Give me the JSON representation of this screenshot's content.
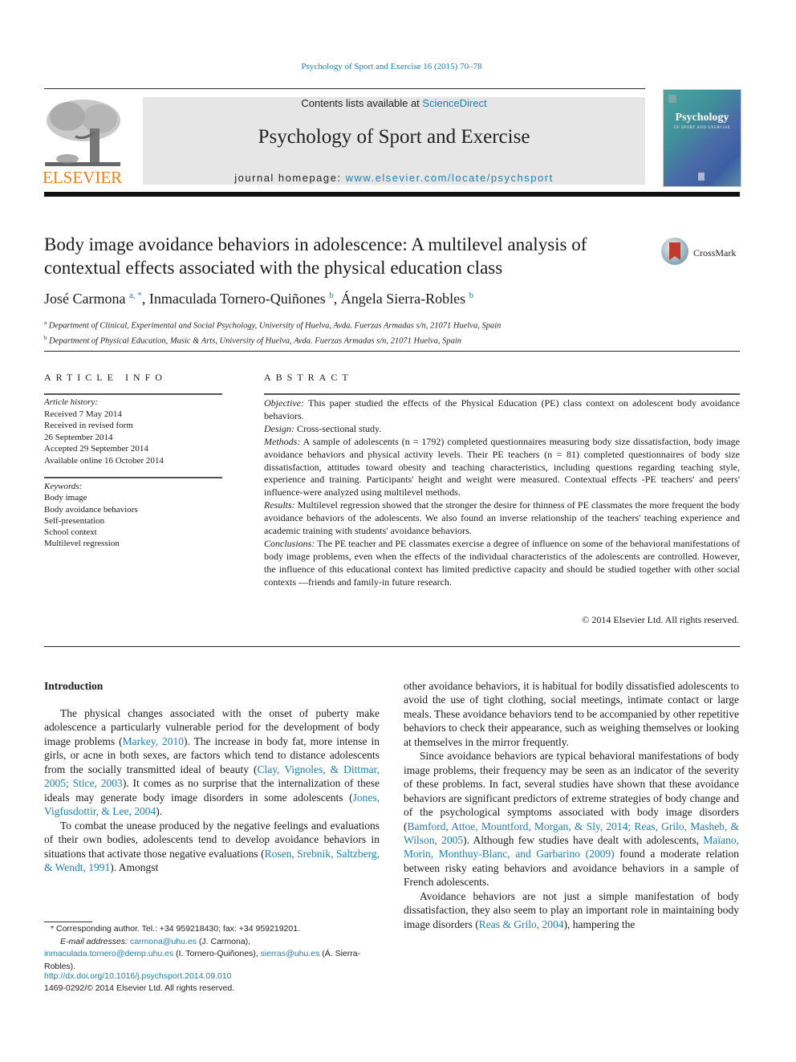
{
  "citation": "Psychology of Sport and Exercise 16 (2015) 70–78",
  "header": {
    "publisher_logo": "ELSEVIER",
    "contents_prefix": "Contents lists available at ",
    "contents_link": "ScienceDirect",
    "journal_title": "Psychology of Sport and Exercise",
    "homepage_prefix": "journal homepage: ",
    "homepage_link": "www.elsevier.com/locate/psychsport",
    "cover_title": "Psychology",
    "cover_subtitle": "OF SPORT AND EXERCISE"
  },
  "article": {
    "title": "Body image avoidance behaviors in adolescence: A multilevel analysis of contextual effects associated with the physical education class",
    "crossmark_label": "CrossMark",
    "authors": [
      {
        "name": "José Carmona",
        "sup": "a, *"
      },
      {
        "name": "Inmaculada Tornero-Quiñones",
        "sup": "b"
      },
      {
        "name": "Ángela Sierra-Robles",
        "sup": "b"
      }
    ],
    "affiliations": [
      {
        "mark": "a",
        "text": "Department of Clinical, Experimental and Social Psychology, University of Huelva, Avda. Fuerzas Armadas s/n, 21071 Huelva, Spain"
      },
      {
        "mark": "b",
        "text": "Department of Physical Education, Music & Arts, University of Huelva, Avda. Fuerzas Armadas s/n, 21071 Huelva, Spain"
      }
    ]
  },
  "article_info": {
    "heading": "ARTICLE INFO",
    "history_label": "Article history:",
    "history": [
      "Received 7 May 2014",
      "Received in revised form",
      "26 September 2014",
      "Accepted 29 September 2014",
      "Available online 16 October 2014"
    ],
    "keywords_label": "Keywords:",
    "keywords": [
      "Body image",
      "Body avoidance behaviors",
      "Self-presentation",
      "School context",
      "Multilevel regression"
    ]
  },
  "abstract": {
    "heading": "ABSTRACT",
    "sections": [
      {
        "label": "Objective:",
        "text": " This paper studied the effects of the Physical Education (PE) class context on adolescent body avoidance behaviors."
      },
      {
        "label": "Design:",
        "text": " Cross-sectional study."
      },
      {
        "label": "Methods:",
        "text": " A sample of adolescents (n = 1792) completed questionnaires measuring body size dissatisfaction, body image avoidance behaviors and physical activity levels. Their PE teachers (n = 81) completed questionnaires of body size dissatisfaction, attitudes toward obesity and teaching characteristics, including questions regarding teaching style, experience and training. Participants' height and weight were measured. Contextual effects -PE teachers' and peers' influence-were analyzed using multilevel methods."
      },
      {
        "label": "Results:",
        "text": " Multilevel regression showed that the stronger the desire for thinness of PE classmates the more frequent the body avoidance behaviors of the adolescents. We also found an inverse relationship of the teachers' teaching experience and academic training with students' avoidance behaviors."
      },
      {
        "label": "Conclusions:",
        "text": " The PE teacher and PE classmates exercise a degree of influence on some of the behavioral manifestations of body image problems, even when the effects of the individual characteristics of the adolescents are controlled. However, the influence of this educational context has limited predictive capacity and should be studied together with other social contexts —friends and family-in future research."
      }
    ],
    "copyright": "© 2014 Elsevier Ltd. All rights reserved."
  },
  "body": {
    "intro_heading": "Introduction",
    "left": {
      "p1": {
        "t1": "The physical changes associated with the onset of puberty make adolescence a particularly vulnerable period for the development of body image problems (",
        "c1": "Markey, 2010",
        "t2": "). The increase in body fat, more intense in girls, or acne in both sexes, are factors which tend to distance adolescents from the socially transmitted ideal of beauty (",
        "c2": "Clay, Vignoles, & Dittmar, 2005; Stice, 2003",
        "t3": "). It comes as no surprise that the internalization of these ideals may generate body image disorders in some adolescents (",
        "c3": "Jones, Vigfusdottir, & Lee, 2004",
        "t4": ")."
      },
      "p2": {
        "t1": "To combat the unease produced by the negative feelings and evaluations of their own bodies, adolescents tend to develop avoidance behaviors in situations that activate those negative evaluations (",
        "c1": "Rosen, Srebnik, Saltzberg, & Wendt, 1991",
        "t2": "). Amongst"
      }
    },
    "right": {
      "p1": "other avoidance behaviors, it is habitual for bodily dissatisfied adolescents to avoid the use of tight clothing, social meetings, intimate contact or large meals. These avoidance behaviors tend to be accompanied by other repetitive behaviors to check their appearance, such as weighing themselves or looking at themselves in the mirror frequently.",
      "p2": {
        "t1": "Since avoidance behaviors are typical behavioral manifestations of body image problems, their frequency may be seen as an indicator of the severity of these problems. In fact, several studies have shown that these avoidance behaviors are significant predictors of extreme strategies of body change and of the psychological symptoms associated with body image disorders (",
        "c1": "Bamford, Attoe, Mountford, Morgan, & Sly, 2014; Reas, Grilo, Masheb, & Wilson, 2005",
        "t2": "). Although few studies have dealt with adolescents, ",
        "c2": "Maïano, Morin, Monthuy-Blanc, and Garbarino (2009)",
        "t3": " found a moderate relation between risky eating behaviors and avoidance behaviors in a sample of French adolescents."
      },
      "p3": {
        "t1": "Avoidance behaviors are not just a simple manifestation of body dissatisfaction, they also seem to play an important role in maintaining body image disorders (",
        "c1": "Reas & Grilo, 2004",
        "t2": "), hampering the"
      }
    }
  },
  "footnote": {
    "corresponding": "* Corresponding author. Tel.: +34 959218430; fax: +34 959219201.",
    "email_label": "E-mail addresses:",
    "emails": [
      {
        "address": "carmona@uhu.es",
        "owner": " (J. Carmona), "
      },
      {
        "address": "inmaculada.tornero@demp.uhu.es",
        "owner": " (I. Tornero-Quiñones), "
      },
      {
        "address": "sierras@uhu.es",
        "owner": " (Á. Sierra-Robles)."
      }
    ],
    "doi": "http://dx.doi.org/10.1016/j.psychsport.2014.09.010",
    "issn": "1469-0292/© 2014 Elsevier Ltd. All rights reserved."
  },
  "colors": {
    "link": "#1f7fb5",
    "elsevier_orange": "#f07f1a",
    "masthead_bg": "#e6e6e6",
    "crossmark_red": "#c0392b"
  }
}
